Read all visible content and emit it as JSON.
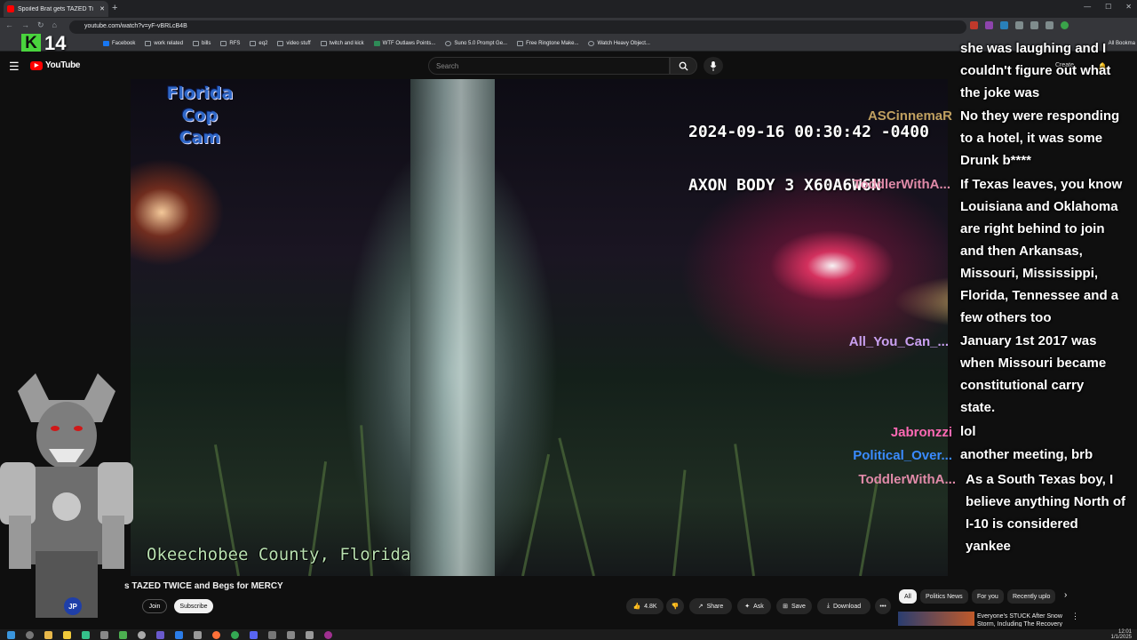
{
  "browser": {
    "tab_title": "Spoiled Brat gets TAZED Ti",
    "url": "youtube.com/watch?v=yF-vBRLcB4B",
    "bookmarks": [
      "Facebook",
      "work related",
      "bills",
      "RFS",
      "eq2",
      "video stuff",
      "twitch and kick",
      "WTF Outlaws Points...",
      "Suno 5.0 Prompt Ge...",
      "Free Ringtone Make...",
      "Watch Heavy Object..."
    ],
    "bookmarks_more": "All Bookma"
  },
  "youtube": {
    "logo": "YouTube",
    "search_placeholder": "Search",
    "create_label": "Create"
  },
  "video": {
    "channel_overlay": [
      "Florida",
      "Cop",
      "Cam"
    ],
    "timestamp_line1": "2024-09-16 00:30:42 -0400",
    "timestamp_line2": "AXON BODY 3 X60A6W6N",
    "location": "Okeechobee County, Florida"
  },
  "stream_overlay": {
    "k_letter": "K",
    "k_count": "14"
  },
  "chat": [
    {
      "user": "",
      "user_color": "#ffffff",
      "lines": [
        "she was laughing and I",
        "couldn't figure out what",
        "the joke was"
      ]
    },
    {
      "user": "ASCinnemaR",
      "user_color": "#c0a060",
      "lines": [
        "No they were responding",
        "to a hotel, it was some",
        "Drunk b****"
      ]
    },
    {
      "user": "ToddlerWithA...",
      "user_color": "#e08aa8",
      "lines": [
        "If Texas leaves, you know",
        "Louisiana and Oklahoma",
        "are right behind to join",
        "and then Arkansas,",
        "Missouri, Mississippi,",
        "Florida, Tennessee and a",
        "few others too"
      ]
    },
    {
      "user": "All_You_Can_...",
      "user_color": "#c9a0f0",
      "lines": [
        "January 1st 2017 was",
        "when Missouri became",
        "constitutional carry",
        "state."
      ]
    },
    {
      "user": "Jabronzzi",
      "user_color": "#ff69b4",
      "lines": [
        "lol"
      ]
    },
    {
      "user": "Political_Over...",
      "user_color": "#3a8bff",
      "lines": [
        "another meeting, brb"
      ]
    },
    {
      "user": "ToddlerWithA...",
      "user_color": "#e08aa8",
      "lines": [
        "As a South Texas boy, I",
        "believe anything North of",
        "I-10 is considered",
        "yankee"
      ]
    }
  ],
  "below_video": {
    "title": "s TAZED TWICE and Begs for MERCY",
    "channel_initials": "JP",
    "join_label": "Join",
    "subscribe_label": "Subscribe",
    "like_count": "4.8K",
    "share_label": "Share",
    "ask_label": "Ask",
    "save_label": "Save",
    "download_label": "Download",
    "more_label": "•••"
  },
  "recommendations": {
    "chips": [
      "All",
      "Politics News",
      "For you",
      "Recently uplo"
    ],
    "first_title": "Everyone's STUCK After Snow Storm, Including The Recovery"
  },
  "taskbar": {
    "time": "12:01",
    "date": "1/1/2025"
  },
  "colors": {
    "youtube_red": "#ff0000",
    "k_green": "#49d43d",
    "overlay_blue": "#2f68c8"
  }
}
